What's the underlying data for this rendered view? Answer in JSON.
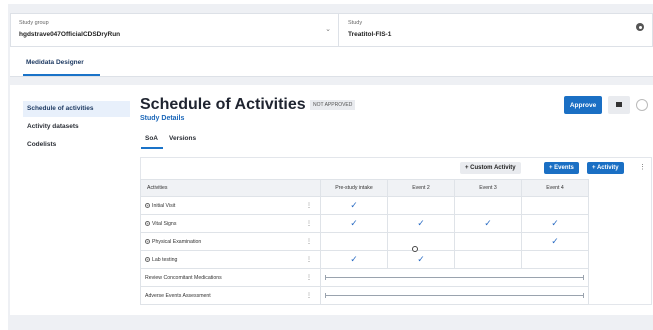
{
  "study_group": {
    "label": "Study group",
    "value": "hgdstrave047OfficialCDSDryRun"
  },
  "study": {
    "label": "Study",
    "value": "Treatitol-FIS-1"
  },
  "app_tab": "Medidata Designer",
  "nav": [
    "Schedule of activities",
    "Activity datasets",
    "Codelists"
  ],
  "page": {
    "title": "Schedule of Activities",
    "status": "NOT APPROVED",
    "subtitle": "Study Details",
    "approve": "Approve"
  },
  "tabs": [
    "SoA",
    "Versions"
  ],
  "toolbar": {
    "custom": "+ Custom Activity",
    "events": "+ Events",
    "activity": "+ Activity"
  },
  "table": {
    "header": "Activities",
    "events": [
      "Pre-study intake",
      "Event 2",
      "Event 3",
      "Event 4"
    ],
    "rows": [
      {
        "name": "Initial Visit",
        "marks": [
          true,
          false,
          false,
          false
        ]
      },
      {
        "name": "Vital Signs",
        "marks": [
          true,
          true,
          true,
          true
        ]
      },
      {
        "name": "Physical Examination",
        "marks": [
          false,
          false,
          false,
          true
        ]
      },
      {
        "name": "Lab testing",
        "marks": [
          true,
          true,
          false,
          false
        ]
      }
    ],
    "span_rows": [
      "Review Concomitant Medications",
      "Adverse Events Assessment"
    ]
  }
}
